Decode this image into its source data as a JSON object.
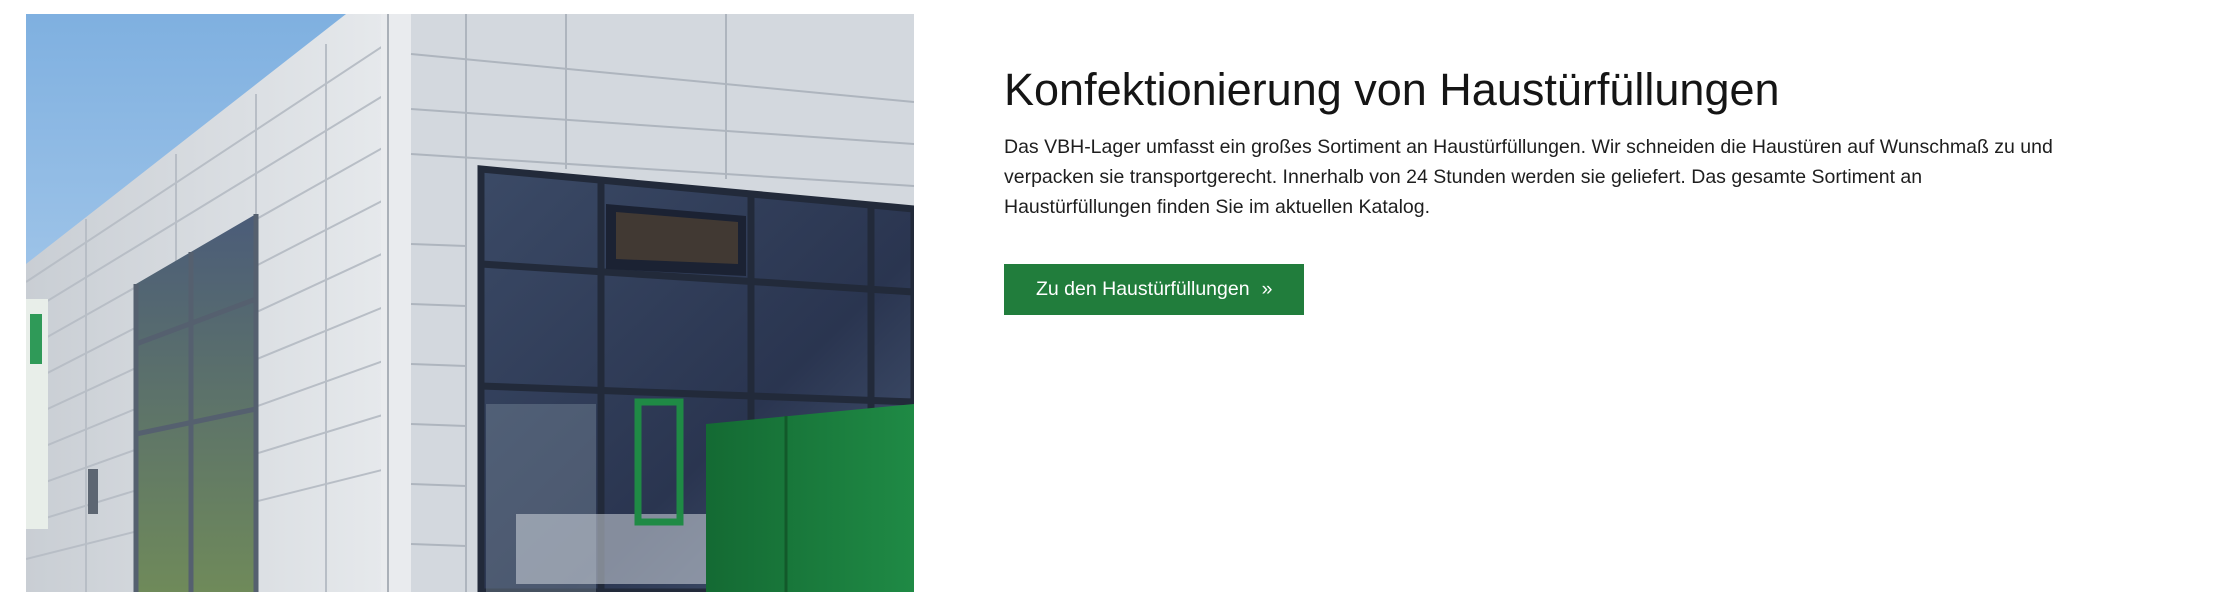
{
  "section": {
    "title": "Konfektionierung von Haustürfüllungen",
    "description": "Das VBH-Lager umfasst ein großes Sortiment an Haustürfüllungen. Wir schneiden die Haustüren auf Wunschmaß zu und verpacken sie transportgerecht. Innerhalb von 24 Stunden werden sie geliefert. Das gesamte Sortiment an Haustürfüllungen finden Sie im aktuellen Katalog.",
    "button_label": "Zu den Haustürfüllungen",
    "button_arrow": "»"
  },
  "colors": {
    "button_bg": "#217d3c",
    "sky": "#9cc3e8",
    "facade": "#d9dde2",
    "glass": "#2f3d57",
    "green_panel": "#1c7a3c"
  }
}
